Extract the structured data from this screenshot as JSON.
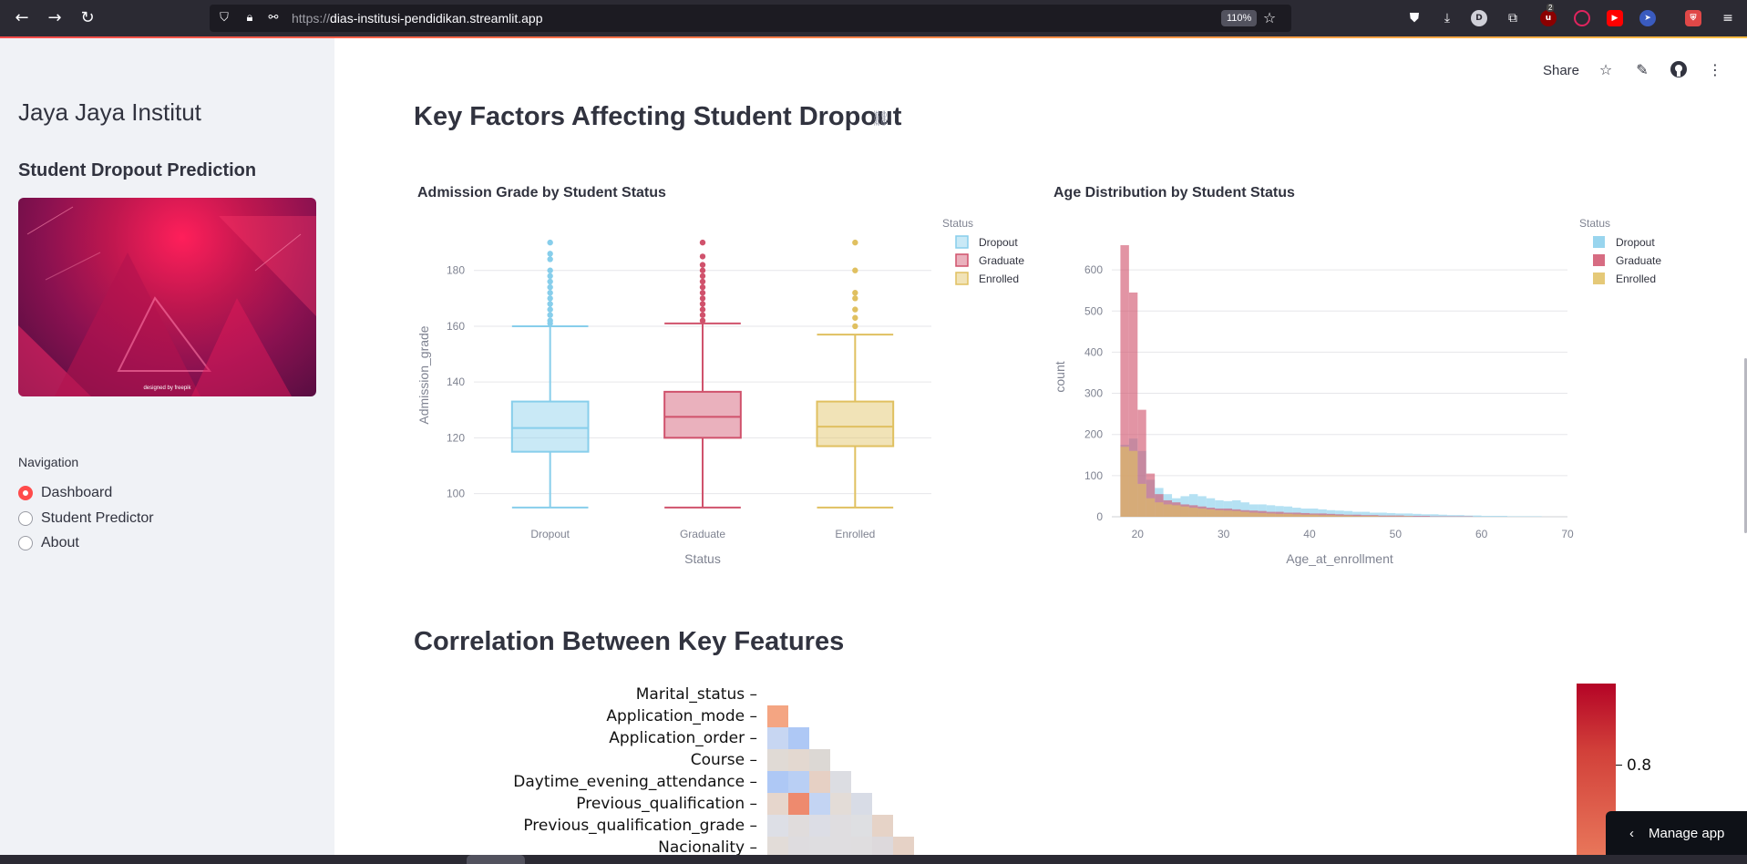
{
  "browser": {
    "url_scheme": "https://",
    "url_host": "dias-institusi-pendidikan.streamlit.app",
    "zoom": "110%",
    "extension_badge": "2"
  },
  "sidebar": {
    "title": "Jaya Jaya Institut",
    "subtitle": "Student Dropout Prediction",
    "image_credit": "designed by freepik",
    "nav_label": "Navigation",
    "nav_items": [
      {
        "label": "Dashboard",
        "selected": true
      },
      {
        "label": "Student Predictor",
        "selected": false
      },
      {
        "label": "About",
        "selected": false
      }
    ]
  },
  "header": {
    "share_label": "Share"
  },
  "main": {
    "section1_title": "Key Factors Affecting Student Dropout",
    "section2_title": "Correlation Between Key Features"
  },
  "colors": {
    "dropout": "#87ceeb",
    "graduate": "#d0526c",
    "enrolled": "#e0c060",
    "accent": "#ff4b4b"
  },
  "chart_data": [
    {
      "type": "box",
      "title": "Admission Grade by Student Status",
      "xlabel": "Status",
      "ylabel": "Admission_grade",
      "ylim": [
        93,
        192
      ],
      "yticks": [
        100,
        120,
        140,
        160,
        180
      ],
      "categories": [
        "Dropout",
        "Graduate",
        "Enrolled"
      ],
      "legend_title": "Status",
      "legend_placement": "top-right",
      "series": [
        {
          "name": "Dropout",
          "min": 95,
          "q1": 115,
          "median": 123.5,
          "q3": 133,
          "max": 160,
          "outliers": [
            161,
            162,
            164,
            166,
            168,
            170,
            172,
            174,
            176,
            178,
            180,
            184,
            186,
            190
          ]
        },
        {
          "name": "Graduate",
          "min": 95,
          "q1": 120,
          "median": 127.5,
          "q3": 136.5,
          "max": 161,
          "outliers": [
            162,
            164,
            166,
            168,
            170,
            172,
            174,
            176,
            178,
            180,
            182,
            185,
            190
          ]
        },
        {
          "name": "Enrolled",
          "min": 95,
          "q1": 117,
          "median": 124,
          "q3": 133,
          "max": 157,
          "outliers": [
            160,
            163,
            166,
            170,
            172,
            180,
            190
          ]
        }
      ]
    },
    {
      "type": "histogram",
      "title": "Age Distribution by Student Status",
      "xlabel": "Age_at_enrollment",
      "ylabel": "count",
      "xlim": [
        17,
        70
      ],
      "ylim": [
        0,
        680
      ],
      "xticks": [
        20,
        30,
        40,
        50,
        60,
        70
      ],
      "yticks": [
        0,
        100,
        200,
        300,
        400,
        500,
        600
      ],
      "legend_title": "Status",
      "legend_placement": "top-right",
      "bin_width": 1,
      "bin_start": 17,
      "series": [
        {
          "name": "Dropout",
          "values": [
            0,
            175,
            190,
            160,
            90,
            70,
            55,
            45,
            50,
            55,
            50,
            45,
            40,
            38,
            40,
            35,
            30,
            30,
            28,
            26,
            25,
            22,
            20,
            20,
            18,
            16,
            15,
            14,
            12,
            12,
            10,
            10,
            9,
            8,
            8,
            7,
            6,
            6,
            5,
            4,
            4,
            3,
            3,
            2,
            2,
            2,
            1,
            1,
            1,
            1,
            0,
            0,
            0
          ]
        },
        {
          "name": "Graduate",
          "values": [
            0,
            660,
            545,
            260,
            105,
            55,
            40,
            35,
            30,
            28,
            25,
            22,
            20,
            20,
            18,
            16,
            15,
            14,
            12,
            12,
            10,
            10,
            9,
            8,
            8,
            7,
            6,
            5,
            5,
            4,
            4,
            3,
            3,
            3,
            2,
            2,
            2,
            1,
            1,
            1,
            1,
            1,
            0,
            0,
            0,
            0,
            0,
            0,
            0,
            0,
            0,
            0,
            0
          ]
        },
        {
          "name": "Enrolled",
          "values": [
            0,
            170,
            160,
            80,
            45,
            35,
            30,
            28,
            25,
            22,
            20,
            18,
            16,
            15,
            14,
            12,
            10,
            9,
            8,
            7,
            7,
            6,
            5,
            5,
            4,
            4,
            3,
            3,
            2,
            2,
            2,
            1,
            1,
            1,
            1,
            0,
            0,
            0,
            0,
            0,
            0,
            0,
            0,
            0,
            0,
            0,
            0,
            0,
            0,
            0,
            0,
            0,
            0
          ]
        }
      ]
    },
    {
      "type": "heatmap",
      "title": "",
      "row_labels": [
        "Marital_status",
        "Application_mode",
        "Application_order",
        "Course",
        "Daytime_evening_attendance",
        "Previous_qualification",
        "Previous_qualification_grade",
        "Nacionality"
      ],
      "colorbar_tick": "0.8",
      "cells": [
        [],
        [
          "#f4a582"
        ],
        [
          "#c7d6f2",
          "#aec8f5"
        ],
        [
          "#e0dad5",
          "#e3d8d0",
          "#dcd8d4"
        ],
        [
          "#aec8f5",
          "#b9cff4",
          "#e6d0c4",
          "#dcdde2"
        ],
        [
          "#e6d6cc",
          "#ee8a6e",
          "#c3d4f3",
          "#e3dcd7",
          "#d8dce6"
        ],
        [
          "#dddfe6",
          "#e0dcdc",
          "#dcdde5",
          "#dfdde0",
          "#dedfe2",
          "#e6d3c7"
        ],
        [
          "#e2dcd8",
          "#dedcdf",
          "#dedde0",
          "#dfdde0",
          "#dfdddf",
          "#ddd9dc",
          "#e6d2c6"
        ]
      ]
    }
  ]
}
